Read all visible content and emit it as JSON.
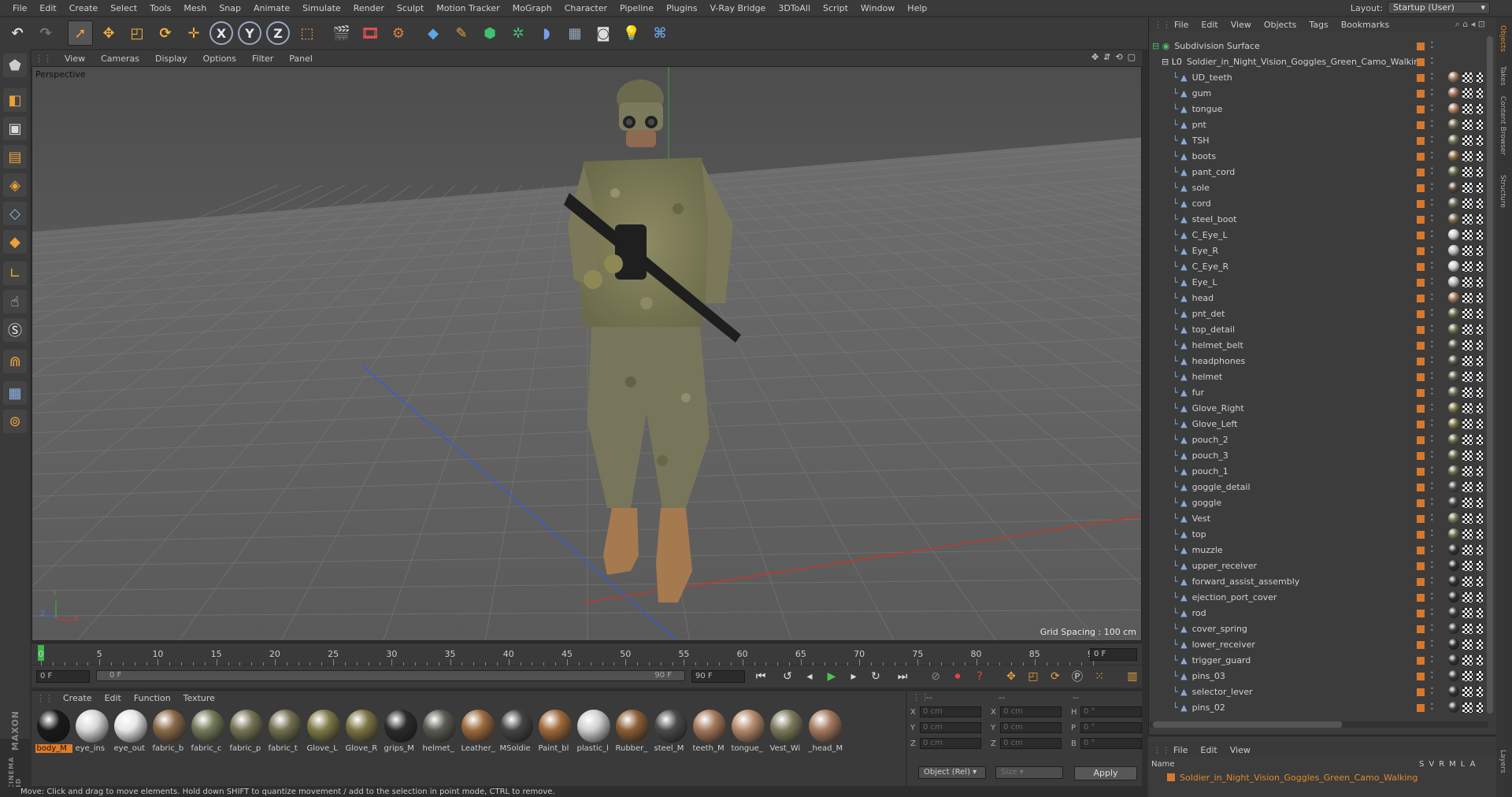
{
  "menubar": {
    "items": [
      "File",
      "Edit",
      "Create",
      "Select",
      "Tools",
      "Mesh",
      "Snap",
      "Animate",
      "Simulate",
      "Render",
      "Sculpt",
      "Motion Tracker",
      "MoGraph",
      "Character",
      "Pipeline",
      "Plugins",
      "V-Ray Bridge",
      "3DToAll",
      "Script",
      "Window",
      "Help"
    ],
    "layout_label": "Layout:",
    "layout_value": "Startup (User)"
  },
  "toolbar": {
    "icons": [
      "undo-icon",
      "redo-icon",
      "live-selection-icon",
      "move-icon",
      "scale-icon",
      "rotate-icon",
      "create-move-icon",
      "x-axis-icon",
      "y-axis-icon",
      "z-axis-icon",
      "coordinate-system-icon",
      "render-view-icon",
      "render-picture-viewer-icon",
      "render-settings-icon",
      "cube-icon",
      "pen-icon",
      "subdivision-icon",
      "mograph-icon",
      "deformer-icon",
      "floor-icon",
      "camera-icon",
      "light-icon",
      "python-icon"
    ],
    "axis_labels": [
      "X",
      "Y",
      "Z"
    ]
  },
  "left_tools": [
    "make-editable-icon",
    "texture-mode-icon",
    "workplane-icon",
    "points-mode-icon",
    "edges-mode-icon",
    "polygons-mode-icon",
    "axis-mode-icon",
    "tweak-icon",
    "snap-icon",
    "magnet-icon",
    "grid-icon",
    "stereo-icon"
  ],
  "brand": {
    "line1": "MAXON",
    "line2": "CINEMA 4D"
  },
  "viewport": {
    "menu": [
      "View",
      "Cameras",
      "Display",
      "Options",
      "Filter",
      "Panel"
    ],
    "label": "Perspective",
    "grid_spacing": "Grid Spacing : 100 cm",
    "accent_x_axis": "#c0392b",
    "accent_y_axis": "#3aa14a",
    "accent_z_axis": "#3a5bd1",
    "axis_letters": [
      "Y",
      "Z",
      "X"
    ]
  },
  "timeline": {
    "labels": [
      "0",
      "5",
      "10",
      "15",
      "20",
      "25",
      "30",
      "35",
      "40",
      "45",
      "50",
      "55",
      "60",
      "65",
      "70",
      "75",
      "80",
      "85",
      "90"
    ],
    "current": "0 F"
  },
  "playbar": {
    "start": "0 F",
    "range_start": "0 F",
    "range_end": "90 F",
    "end": "90 F"
  },
  "materials": {
    "menu": [
      "Create",
      "Edit",
      "Function",
      "Texture"
    ],
    "items": [
      {
        "name": "body_M",
        "color": "#1a1a1a",
        "selected": true
      },
      {
        "name": "eye_ins",
        "color": "#d8d8d8"
      },
      {
        "name": "eye_out",
        "color": "#e6e6e6"
      },
      {
        "name": "fabric_b",
        "color": "#8a6a48"
      },
      {
        "name": "fabric_c",
        "color": "#737a5a"
      },
      {
        "name": "fabric_p",
        "color": "#767556"
      },
      {
        "name": "fabric_t",
        "color": "#72704f"
      },
      {
        "name": "Glove_L",
        "color": "#7e7a48"
      },
      {
        "name": "Glove_R",
        "color": "#7b7443"
      },
      {
        "name": "grips_M",
        "color": "#2b2b2b"
      },
      {
        "name": "helmet_",
        "color": "#5b5b52"
      },
      {
        "name": "Leather_",
        "color": "#9b6a3e"
      },
      {
        "name": "MSoldie",
        "color": "#444"
      },
      {
        "name": "Paint_bl",
        "color": "#a06a3c"
      },
      {
        "name": "plastic_l",
        "color": "#cfcfcf"
      },
      {
        "name": "Rubber_",
        "color": "#8c5e36"
      },
      {
        "name": "steel_M",
        "color": "#4a4a4a"
      },
      {
        "name": "teeth_M",
        "color": "#a5785a"
      },
      {
        "name": "tongue_",
        "color": "#b68a6b"
      },
      {
        "name": "Vest_Wi",
        "color": "#7d7a5c"
      },
      {
        "name": "_head_M",
        "color": "#a57a5f"
      }
    ]
  },
  "attributes": {
    "header_dashes": [
      "--",
      "--",
      "--"
    ],
    "rows": [
      {
        "l1": "X",
        "v1": "0 cm",
        "l2": "X",
        "v2": "0 cm",
        "l3": "H",
        "v3": "0 °"
      },
      {
        "l1": "Y",
        "v1": "0 cm",
        "l2": "Y",
        "v2": "0 cm",
        "l3": "P",
        "v3": "0 °"
      },
      {
        "l1": "Z",
        "v1": "0 cm",
        "l2": "Z",
        "v2": "0 cm",
        "l3": "B",
        "v3": "0 °"
      }
    ],
    "mode": "Object (Rel)",
    "size": "Size",
    "apply": "Apply"
  },
  "status": "Move: Click and drag to move elements. Hold down SHIFT to quantize movement / add to the selection in point mode, CTRL to remove.",
  "objects": {
    "menu": [
      "File",
      "Edit",
      "View",
      "Objects",
      "Tags",
      "Bookmarks"
    ],
    "root": "Subdivision Surface",
    "group": "Soldier_in_Night_Vision_Goggles_Green_Camo_Walking",
    "items": [
      {
        "name": "UD_teeth",
        "tag": "#9a7a62"
      },
      {
        "name": "gum",
        "tag": "#a0705a"
      },
      {
        "name": "tongue",
        "tag": "#b08060"
      },
      {
        "name": "pnt",
        "tag": "#6b6b55"
      },
      {
        "name": "TSH",
        "tag": "#6e6e56"
      },
      {
        "name": "boots",
        "tag": "#8a6a45"
      },
      {
        "name": "pant_cord",
        "tag": "#6a6a4e"
      },
      {
        "name": "sole",
        "tag": "#5a4a3a"
      },
      {
        "name": "cord",
        "tag": "#6b6b55"
      },
      {
        "name": "steel_boot",
        "tag": "#7a6a4a"
      },
      {
        "name": "C_Eye_L",
        "tag": "#d0d0d0"
      },
      {
        "name": "Eye_R",
        "tag": "#bdbdbd"
      },
      {
        "name": "C_Eye_R",
        "tag": "#d0d0d0"
      },
      {
        "name": "Eye_L",
        "tag": "#bdbdbd"
      },
      {
        "name": "head",
        "tag": "#a07a5f"
      },
      {
        "name": "pnt_det",
        "tag": "#6a6a50"
      },
      {
        "name": "top_detail",
        "tag": "#717152"
      },
      {
        "name": "helmet_belt",
        "tag": "#5a5a4e"
      },
      {
        "name": "headphones",
        "tag": "#55554a"
      },
      {
        "name": "helmet",
        "tag": "#60604f"
      },
      {
        "name": "fur",
        "tag": "#6a6a55"
      },
      {
        "name": "Glove_Right",
        "tag": "#7d7845"
      },
      {
        "name": "Glove_Left",
        "tag": "#7d7845"
      },
      {
        "name": "pouch_2",
        "tag": "#6a6a52"
      },
      {
        "name": "pouch_3",
        "tag": "#6a6a52"
      },
      {
        "name": "pouch_1",
        "tag": "#6a6a52"
      },
      {
        "name": "goggle_detail",
        "tag": "#4a4a4a"
      },
      {
        "name": "goggle",
        "tag": "#444444"
      },
      {
        "name": "Vest",
        "tag": "#7a7858"
      },
      {
        "name": "top",
        "tag": "#717152"
      },
      {
        "name": "muzzle",
        "tag": "#333333"
      },
      {
        "name": "upper_receiver",
        "tag": "#2e2e2e"
      },
      {
        "name": "forward_assist_assembly",
        "tag": "#333333"
      },
      {
        "name": "ejection_port_cover",
        "tag": "#2e2e2e"
      },
      {
        "name": "rod",
        "tag": "#3a3a3a"
      },
      {
        "name": "cover_spring",
        "tag": "#3a3a3a"
      },
      {
        "name": "lower_receiver",
        "tag": "#2e2e2e"
      },
      {
        "name": "trigger_guard",
        "tag": "#333333"
      },
      {
        "name": "pins_03",
        "tag": "#3a3a3a"
      },
      {
        "name": "selector_lever",
        "tag": "#333333"
      },
      {
        "name": "pins_02",
        "tag": "#3a3a3a"
      }
    ]
  },
  "sidetabs": [
    "Objects",
    "Takes",
    "Content Browser",
    "Structure",
    "Layers"
  ],
  "layers": {
    "menu": [
      "File",
      "Edit",
      "View"
    ],
    "head_name": "Name",
    "head_cols": [
      "S",
      "V",
      "R",
      "M",
      "L",
      "A"
    ],
    "row": "Soldier_in_Night_Vision_Goggles_Green_Camo_Walking"
  }
}
